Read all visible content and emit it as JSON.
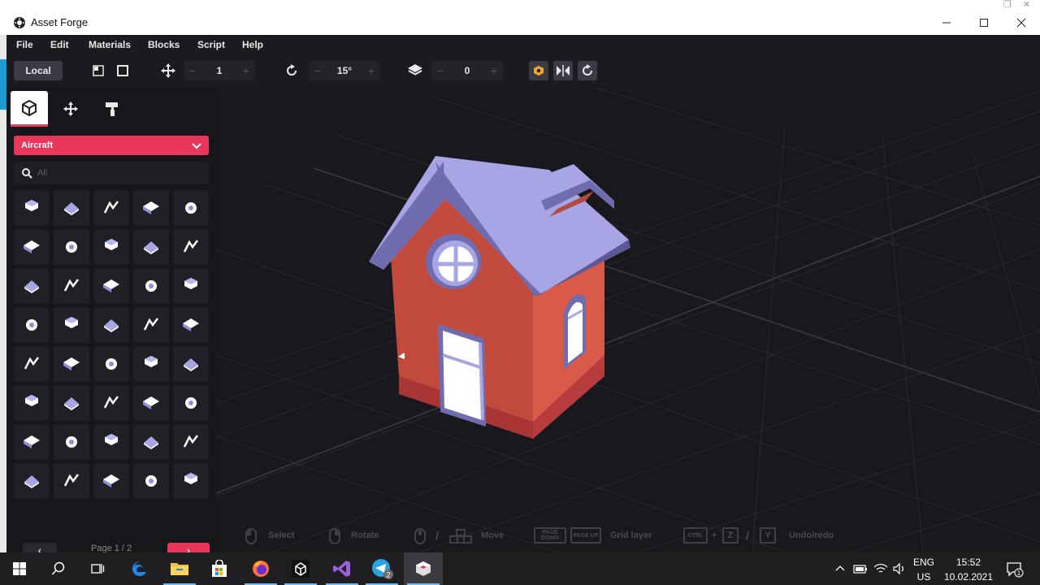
{
  "window": {
    "title": "Asset Forge"
  },
  "menu": [
    "File",
    "Edit",
    "Materials",
    "Blocks",
    "Script",
    "Help"
  ],
  "toolbar": {
    "space_label": "Local",
    "move_step": "1",
    "rotate_step": "15°",
    "layer": "0",
    "minus": "−",
    "plus": "+"
  },
  "panel": {
    "category": "Aircraft",
    "search_placeholder": "All",
    "page_label": "Page 1 / 2",
    "prev": "‹",
    "next": "›",
    "block_count": 40
  },
  "hints": {
    "select": "Select",
    "rotate": "Rotate",
    "move": "Move",
    "grid_layer": "Grid layer",
    "undo_redo": "Undo/redo",
    "page_down": "PAGE DOWN",
    "page_up": "PAGE UP",
    "ctrl": "CTRL",
    "z": "Z",
    "y": "Y",
    "plus": "+",
    "slash": "/"
  },
  "taskbar": {
    "lang": "ENG",
    "region": "US",
    "time": "15:52",
    "date": "10.02.2021",
    "telegram_badge": "2",
    "notif_badge": "1"
  },
  "colors": {
    "accent": "#e8375a",
    "roof": "#a9a7e6",
    "wall": "#d9543f",
    "panel_bg": "#17161b",
    "viewport_bg": "#19181d"
  }
}
